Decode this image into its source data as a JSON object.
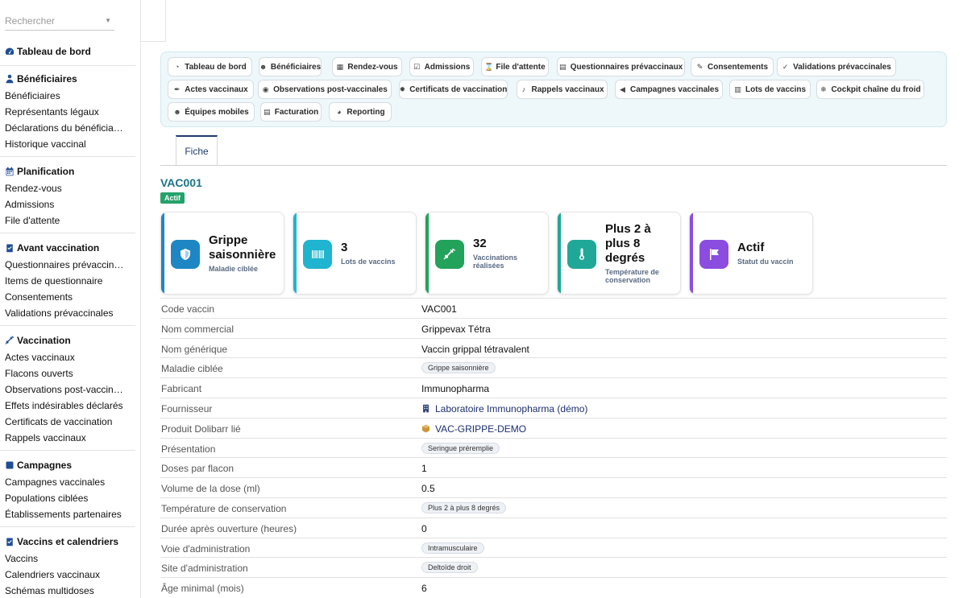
{
  "sidebar": {
    "search_placeholder": "Rechercher",
    "dashboard": "Tableau de bord",
    "sections": [
      {
        "title": "Bénéficiaires",
        "items": [
          "Bénéficiaires",
          "Représentants légaux",
          "Déclarations du bénéficia…",
          "Historique vaccinal"
        ]
      },
      {
        "title": "Planification",
        "items": [
          "Rendez-vous",
          "Admissions",
          "File d'attente"
        ]
      },
      {
        "title": "Avant vaccination",
        "items": [
          "Questionnaires prévaccin…",
          "Items de questionnaire",
          "Consentements",
          "Validations prévaccinales"
        ]
      },
      {
        "title": "Vaccination",
        "items": [
          "Actes vaccinaux",
          "Flacons ouverts",
          "Observations post-vaccin…",
          "Effets indésirables déclarés",
          "Certificats de vaccination",
          "Rappels vaccinaux"
        ]
      },
      {
        "title": "Campagnes",
        "items": [
          "Campagnes vaccinales",
          "Populations ciblées",
          "Établissements partenaires"
        ]
      },
      {
        "title": "Vaccins et calendriers",
        "items": [
          "Vaccins",
          "Calendriers vaccinaux",
          "Schémas multidoses"
        ]
      }
    ]
  },
  "tabs": [
    {
      "label": "Tableau de bord",
      "icon": "gauge-icon"
    },
    {
      "label": "Bénéficiaires",
      "icon": "people-icon"
    },
    {
      "label": "Rendez-vous",
      "icon": "calendar-icon"
    },
    {
      "label": "Admissions",
      "icon": "clipboard-check-icon"
    },
    {
      "label": "File d'attente",
      "icon": "hourglass-icon"
    },
    {
      "label": "Questionnaires prévaccinaux",
      "icon": "clipboard-icon"
    },
    {
      "label": "Consentements",
      "icon": "signature-icon"
    },
    {
      "label": "Validations prévaccinales",
      "icon": "user-check-icon"
    },
    {
      "label": "Actes vaccinaux",
      "icon": "syringe-icon"
    },
    {
      "label": "Observations post-vaccinales",
      "icon": "eye-icon"
    },
    {
      "label": "Certificats de vaccination",
      "icon": "certificate-icon"
    },
    {
      "label": "Rappels vaccinaux",
      "icon": "bell-icon"
    },
    {
      "label": "Campagnes vaccinales",
      "icon": "megaphone-icon"
    },
    {
      "label": "Lots de vaccins",
      "icon": "barcode-icon"
    },
    {
      "label": "Cockpit chaîne du froid",
      "icon": "snowflake-icon"
    },
    {
      "label": "Équipes mobiles",
      "icon": "team-icon"
    },
    {
      "label": "Facturation",
      "icon": "invoice-icon"
    },
    {
      "label": "Reporting",
      "icon": "pie-chart-icon"
    }
  ],
  "record": {
    "tab_label": "Fiche",
    "ref": "VAC001",
    "status": "Actif"
  },
  "cards": [
    {
      "value": "Grippe saisonnière",
      "label": "Maladie ciblée",
      "color": "#1f86c4",
      "icon": "shield-icon"
    },
    {
      "value": "3",
      "label": "Lots de vaccins",
      "color": "#1fb4cf",
      "icon": "barcode-icon"
    },
    {
      "value": "32",
      "label": "Vaccinations réalisées",
      "color": "#22a25a",
      "icon": "syringe-icon"
    },
    {
      "value": "Plus 2 à plus 8 degrés",
      "label": "Température de conservation",
      "color": "#1fa898",
      "icon": "thermometer-icon"
    },
    {
      "value": "Actif",
      "label": "Statut du vaccin",
      "color": "#8b4ce0",
      "icon": "flag-icon"
    }
  ],
  "fields": [
    {
      "label": "Code vaccin",
      "value": "VAC001",
      "kind": "text"
    },
    {
      "label": "Nom commercial",
      "value": "Grippevax Tétra",
      "kind": "text"
    },
    {
      "label": "Nom générique",
      "value": "Vaccin grippal tétravalent",
      "kind": "text"
    },
    {
      "label": "Maladie ciblée",
      "value": "Grippe saisonnière",
      "kind": "chip"
    },
    {
      "label": "Fabricant",
      "value": "Immunopharma",
      "kind": "text"
    },
    {
      "label": "Fournisseur",
      "value": "Laboratoire Immunopharma (démo)",
      "kind": "link-company"
    },
    {
      "label": "Produit Dolibarr lié",
      "value": "VAC-GRIPPE-DEMO",
      "kind": "link-product"
    },
    {
      "label": "Présentation",
      "value": "Seringue préremplie",
      "kind": "chip"
    },
    {
      "label": "Doses par flacon",
      "value": "1",
      "kind": "text"
    },
    {
      "label": "Volume de la dose (ml)",
      "value": "0.5",
      "kind": "text"
    },
    {
      "label": "Température de conservation",
      "value": "Plus 2 à plus 8 degrés",
      "kind": "chip"
    },
    {
      "label": "Durée après ouverture (heures)",
      "value": "0",
      "kind": "text"
    },
    {
      "label": "Voie d'administration",
      "value": "Intramusculaire",
      "kind": "chip"
    },
    {
      "label": "Site d'administration",
      "value": "Deltoïde droit",
      "kind": "chip"
    },
    {
      "label": "Âge minimal (mois)",
      "value": "6",
      "kind": "text"
    }
  ]
}
